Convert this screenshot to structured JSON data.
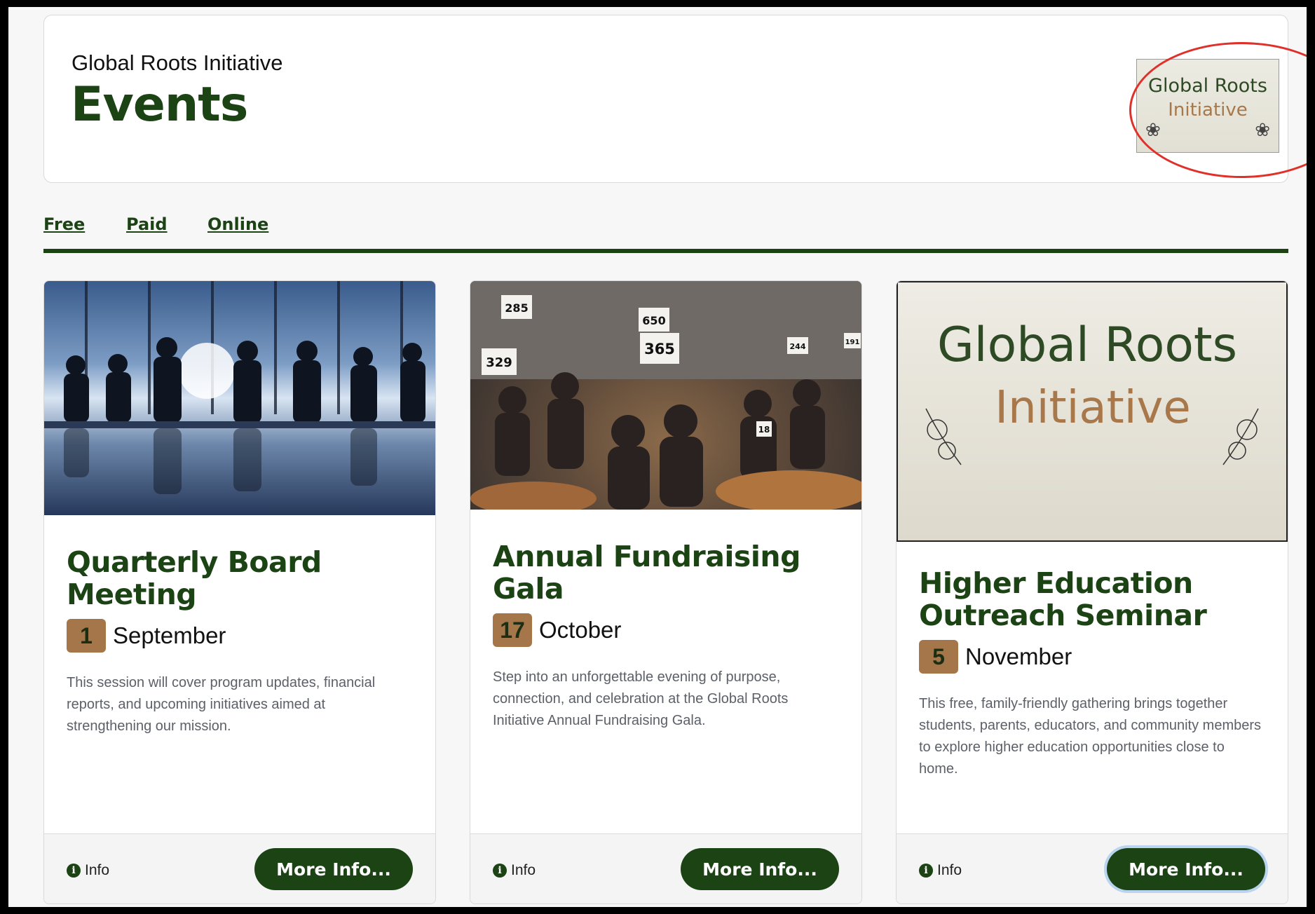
{
  "header": {
    "org_name": "Global Roots Initiative",
    "title": "Events",
    "logo": {
      "line1": "Global Roots",
      "line2": "Initiative"
    }
  },
  "tabs": [
    {
      "label": "Free"
    },
    {
      "label": "Paid"
    },
    {
      "label": "Online"
    }
  ],
  "cards": [
    {
      "title": "Quarterly Board Meeting",
      "day": "1",
      "month": "September",
      "description": "This session will cover program updates, financial reports, and upcoming initiatives aimed at strengthening our mission.",
      "info_label": "Info",
      "button_label": "More Info..."
    },
    {
      "title": "Annual Fundraising Gala",
      "day": "17",
      "month": "October",
      "description": "Step into an unforgettable evening of purpose, connection, and celebration at the Global Roots Initiative Annual Fundraising Gala.",
      "info_label": "Info",
      "button_label": "More Info...",
      "paddles": [
        "285",
        "650",
        "329",
        "365",
        "244",
        "191",
        "18"
      ]
    },
    {
      "title": "Higher Education Outreach Seminar",
      "day": "5",
      "month": "November",
      "description": "This free, family-friendly gathering brings together students, parents, educators, and community members to explore higher education opportunities close to home.",
      "info_label": "Info",
      "button_label": "More Info...",
      "logo": {
        "line1": "Global Roots",
        "line2": "Initiative"
      }
    }
  ],
  "colors": {
    "brand_green": "#1b4314",
    "accent_brown": "#a5764a",
    "highlight_red": "#e0302a"
  }
}
